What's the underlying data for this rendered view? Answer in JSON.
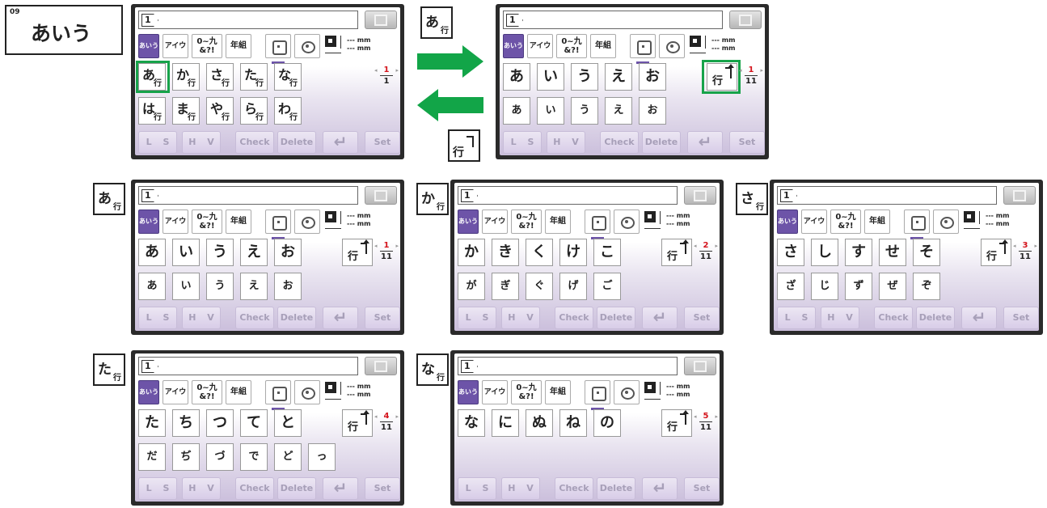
{
  "section_badge": {
    "number": "09",
    "title": "あいう"
  },
  "common": {
    "input_value": "1",
    "tabs": [
      "あいう",
      "アイウ",
      "0~九",
      "&?!",
      "年組"
    ],
    "mm_width": "--- mm",
    "mm_height": "--- mm",
    "gyo_label": "行",
    "bottom": {
      "ls": "L S",
      "hv": "H V",
      "check": "Check",
      "delete": "Delete",
      "enter": "↵",
      "set": "Set"
    }
  },
  "screens": [
    {
      "label": "",
      "row1": [
        "あ",
        "か",
        "さ",
        "た",
        "な"
      ],
      "row2": [
        "は",
        "ま",
        "や",
        "ら",
        "わ"
      ],
      "gyo_keys": true,
      "page_current": "1",
      "page_total": "1"
    },
    {
      "label": "",
      "row1": [
        "あ",
        "い",
        "う",
        "え",
        "お"
      ],
      "row2": [
        "あ",
        "い",
        "う",
        "え",
        "お"
      ],
      "gyo_keys": false,
      "page_current": "1",
      "page_total": "11"
    },
    {
      "label": "あ",
      "row1": [
        "あ",
        "い",
        "う",
        "え",
        "お"
      ],
      "row2": [
        "あ",
        "い",
        "う",
        "え",
        "お"
      ],
      "gyo_keys": false,
      "page_current": "1",
      "page_total": "11"
    },
    {
      "label": "か",
      "row1": [
        "か",
        "き",
        "く",
        "け",
        "こ"
      ],
      "row2": [
        "が",
        "ぎ",
        "ぐ",
        "げ",
        "ご"
      ],
      "gyo_keys": false,
      "page_current": "2",
      "page_total": "11"
    },
    {
      "label": "さ",
      "row1": [
        "さ",
        "し",
        "す",
        "せ",
        "そ"
      ],
      "row2": [
        "ざ",
        "じ",
        "ず",
        "ぜ",
        "ぞ"
      ],
      "gyo_keys": false,
      "page_current": "3",
      "page_total": "11"
    },
    {
      "label": "た",
      "row1": [
        "た",
        "ち",
        "つ",
        "て",
        "と"
      ],
      "row2": [
        "だ",
        "ぢ",
        "づ",
        "で",
        "ど",
        "っ"
      ],
      "gyo_keys": false,
      "page_current": "4",
      "page_total": "11"
    },
    {
      "label": "な",
      "row1": [
        "な",
        "に",
        "ぬ",
        "ね",
        "の"
      ],
      "row2": [],
      "gyo_keys": false,
      "page_current": "5",
      "page_total": "11"
    }
  ],
  "transition_labels": {
    "to_kana": "あ",
    "to_gyo": "行"
  },
  "colors": {
    "accent_green": "#12a548",
    "tab_active": "#6d54a8",
    "page_red": "#d4141c"
  }
}
